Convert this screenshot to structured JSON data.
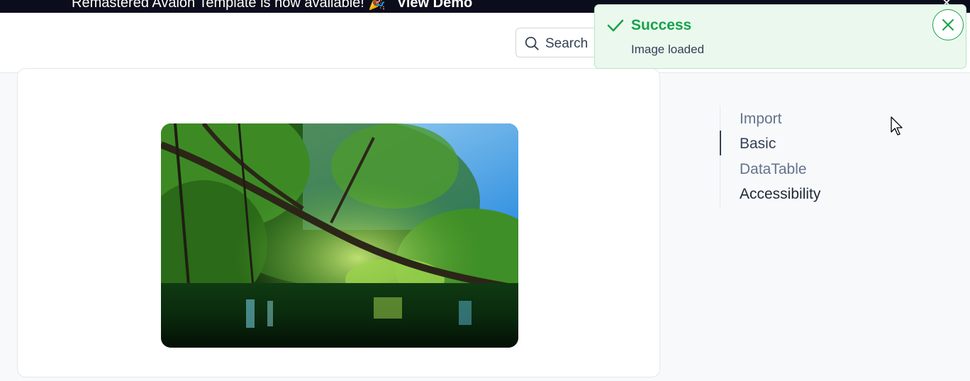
{
  "banner": {
    "text": "Remastered Avalon Template is now available! 🎉",
    "link": "View Demo"
  },
  "header": {
    "search_label": "Search"
  },
  "toast": {
    "title": "Success",
    "message": "Image loaded"
  },
  "toc": {
    "items": [
      {
        "label": "Import"
      },
      {
        "label": "Basic"
      },
      {
        "label": "DataTable"
      },
      {
        "label": "Accessibility"
      }
    ],
    "active_index": 1
  },
  "colors": {
    "success": "#16a34a",
    "toast_bg": "#ebf8ee",
    "banner_bg": "#0b0d1c"
  }
}
